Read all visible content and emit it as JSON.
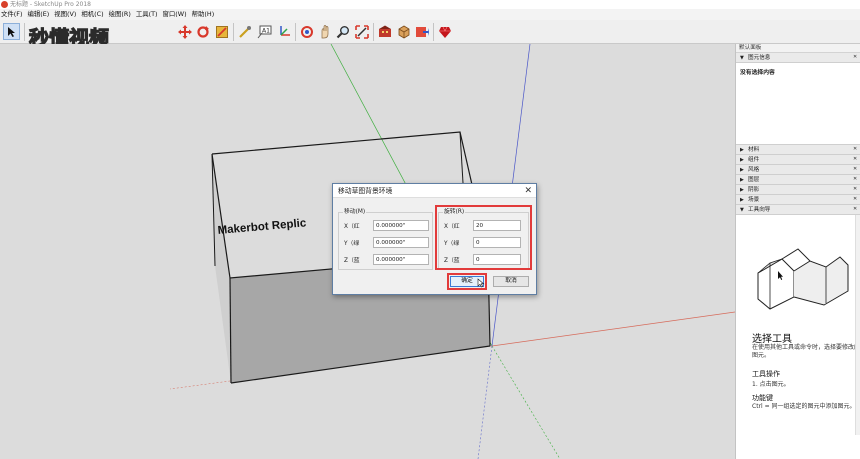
{
  "window": {
    "title": "无标题 - SketchUp Pro 2018"
  },
  "menu": [
    "文件(F)",
    "编辑(E)",
    "视图(V)",
    "相机(C)",
    "绘图(R)",
    "工具(T)",
    "窗口(W)",
    "帮助(H)"
  ],
  "watermark": "秒懂视频",
  "scene": {
    "label": "Makerbot Replic"
  },
  "dialog": {
    "title": "移动草图背景环境",
    "close": "✕",
    "move": {
      "label": "移动(M)",
      "rows": [
        {
          "axis": "X（红",
          "value": "0.000000\""
        },
        {
          "axis": "Y（绿",
          "value": "0.000000\""
        },
        {
          "axis": "Z（蓝",
          "value": "0.000000\""
        }
      ]
    },
    "rotate": {
      "label": "旋转(R)",
      "rows": [
        {
          "axis": "X（红",
          "value": "20"
        },
        {
          "axis": "Y（绿",
          "value": "0"
        },
        {
          "axis": "Z（蓝",
          "value": "0"
        }
      ]
    },
    "ok": "确定",
    "cancel": "取消"
  },
  "panel": {
    "header": "默认面板",
    "entity_tray": "图元信息",
    "entity_text": "没有选择内容",
    "trays": [
      "材料",
      "组件",
      "风格",
      "图层",
      "阴影",
      "场景"
    ],
    "instructor_tray": "工具向导",
    "instructor": {
      "title": "选择工具",
      "desc": "在使用其他工具或命令时，选择要修改的图元。",
      "ops_title": "工具操作",
      "ops_item": "1. 点击图元。",
      "keys_title": "功能键",
      "keys_item": "Ctrl = 同一组选定的图元中添加图元。"
    }
  },
  "colors": {
    "highlight": "#e23b3b",
    "axis_green": "#3fae3f",
    "axis_red": "#d66a5a",
    "axis_blue": "#4a56c8"
  }
}
